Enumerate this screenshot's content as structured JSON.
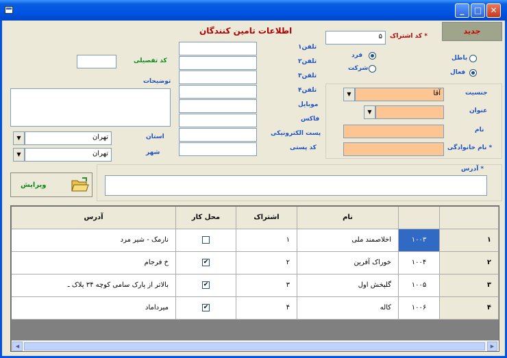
{
  "window": {
    "title": ""
  },
  "header": {
    "form_title": "اطلاعات تامین کنندگان",
    "new_button": "جدید"
  },
  "fields": {
    "membership_code_label": "* کد اشتراک",
    "membership_code_value": "۵",
    "type_person": "فرد",
    "type_company": "شرکت",
    "status_inactive": "باطل",
    "status_active": "فعال",
    "gender_label": "جنسیت",
    "gender_value": "آقا",
    "title_label": "عنوان",
    "name_label": "نام",
    "family_label": "* نام خانوادگی",
    "address_label": "* آدرس",
    "tel1_label": "تلفن۱",
    "tel2_label": "تلفن۲",
    "tel3_label": "تلفن۳",
    "tel4_label": "تلفن۴",
    "mobile_label": "موبایل",
    "fax_label": "فاکس",
    "email_label": "پست الکترونیکی",
    "postal_label": "کد پستی",
    "detail_code_label": "کد تفصیلی",
    "desc_label": "توضیحات",
    "province_label": "استان",
    "province_value": "تهران",
    "city_label": "شهر",
    "city_value": "تهران"
  },
  "save_button": "ویرایش",
  "table": {
    "headers": [
      "",
      "",
      "نام",
      "اشتراک",
      "محل کار",
      "آدرس"
    ],
    "rows": [
      {
        "idx": "۱",
        "code": "۱۰۰۳",
        "name": "اخلاصمند ملی",
        "share": "۱",
        "work": false,
        "address": "نارمک - شیر مرد"
      },
      {
        "idx": "۲",
        "code": "۱۰۰۴",
        "name": "خوراک آفرین",
        "share": "۲",
        "work": true,
        "address": "خ فرجام"
      },
      {
        "idx": "۳",
        "code": "۱۰۰۵",
        "name": "گلپخش اول",
        "share": "۳",
        "work": true,
        "address": "بالاتر از پارک سامی کوچه ۳۴ پلاک ـ"
      },
      {
        "idx": "۴",
        "code": "۱۰۰۶",
        "name": "کاله",
        "share": "۴",
        "work": true,
        "address": "میرداماد"
      }
    ]
  }
}
